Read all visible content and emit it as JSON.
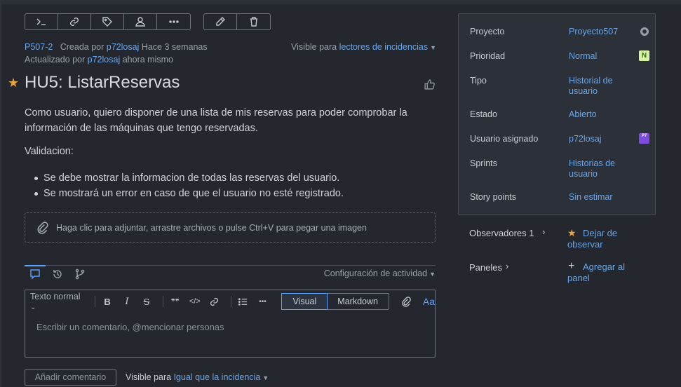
{
  "toolbar": {
    "left_buttons": [
      "terminal-icon",
      "link-icon",
      "tag-icon",
      "user-icon",
      "more-icon"
    ],
    "right_buttons": [
      "pencil-icon",
      "trash-icon"
    ]
  },
  "issue": {
    "key": "P507-2",
    "created_prefix": "Creada por",
    "creator": "p72losaj",
    "created_when": "Hace 3 semanas",
    "updated_prefix": "Actualizado por",
    "updater": "p72losaj",
    "updated_when": "ahora mismo",
    "visible_prefix": "Visible para",
    "visible_value": "lectores de incidencias",
    "title": "HU5: ListarReservas",
    "description": " Como usuario, quiero disponer de una lista de mis reservas para poder comprobar la información de las máquinas que tengo reservadas.",
    "validation_heading": "Validacion:",
    "bullets": [
      "Se debe mostrar la informacion de todas las reservas del usuario.",
      "Se mostrará un error en caso de que el usuario no esté registrado."
    ],
    "attach_hint": "Haga clic para adjuntar, arrastre archivos o pulse Ctrl+V para pegar una imagen"
  },
  "activity": {
    "config_label": "Configuración de actividad"
  },
  "editor": {
    "text_style": "Texto normal",
    "bold": "B",
    "italic": "I",
    "strike": "S",
    "quote": "❞❞",
    "code": "</>",
    "more": "•••",
    "mode_visual": "Visual",
    "mode_markdown": "Markdown",
    "aa": "Aa",
    "placeholder": "Escribir un comentario, @mencionar personas"
  },
  "footer": {
    "add_comment": "Añadir comentario",
    "visible_prefix": "Visible para",
    "visible_value": "Igual que la incidencia"
  },
  "side_panel": {
    "rows": [
      {
        "label": "Proyecto",
        "value": "Proyecto507"
      },
      {
        "label": "Prioridad",
        "value": "Normal",
        "badge": "N"
      },
      {
        "label": "Tipo",
        "value": "Historial de usuario"
      },
      {
        "label": "Estado",
        "value": "Abierto"
      },
      {
        "label": "Usuario asignado",
        "value": "p72losaj",
        "avatar": "P7"
      },
      {
        "label": "Sprints",
        "value": "Historias de usuario"
      },
      {
        "label": "Story points",
        "value": "Sin estimar"
      }
    ]
  },
  "watchers": {
    "label": "Observadores",
    "count": "1",
    "action": "Dejar de observar"
  },
  "boards": {
    "label": "Paneles",
    "action": "Agregar al panel"
  },
  "colors": {
    "background": "#24272e",
    "link": "#6ba6e6",
    "accent": "#5aa3ff",
    "star": "#e8a33d",
    "priority_badge": "#d7f3a1",
    "avatar": "#7d4be0"
  }
}
